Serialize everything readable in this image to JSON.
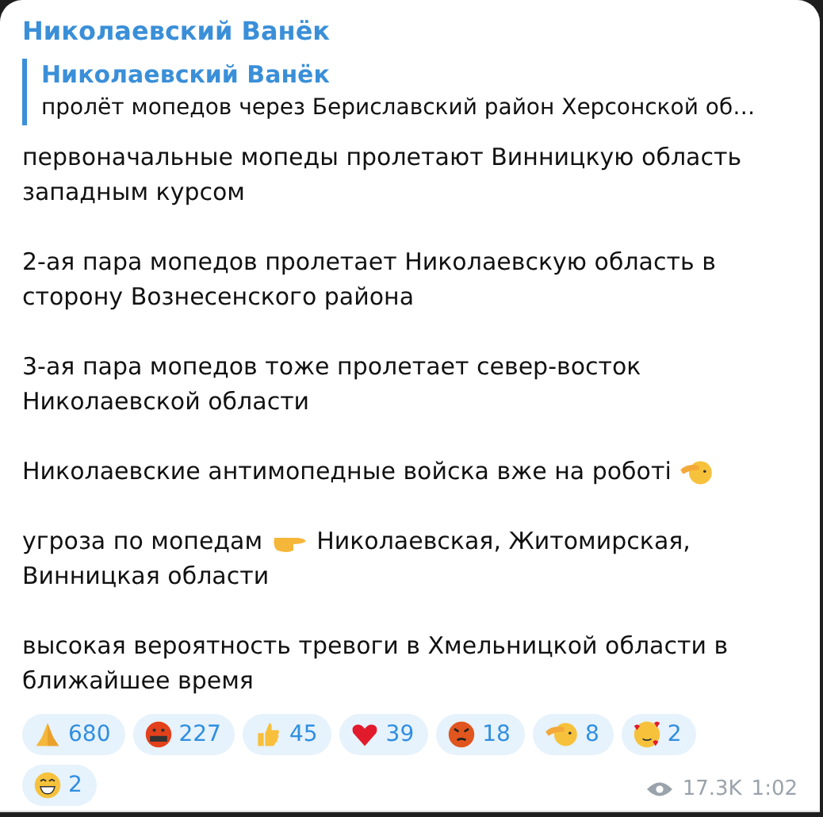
{
  "channel": {
    "name": "Николаевский Ванёк"
  },
  "reply": {
    "author": "Николаевский Ванёк",
    "text": "пролёт мопедов через Бериславский район Херсонской об…"
  },
  "paragraphs": [
    {
      "parts": [
        {
          "kind": "text",
          "text": "первоначальные мопеды пролетают Винницкую область западным курсом"
        }
      ]
    },
    {
      "parts": [
        {
          "kind": "text",
          "text": "2-ая пара мопедов пролетает Николаевскую область в сторону Вознесенского района"
        }
      ]
    },
    {
      "parts": [
        {
          "kind": "text",
          "text": "3-ая пара мопедов тоже пролетает север-восток Николаевской области"
        }
      ]
    },
    {
      "parts": [
        {
          "kind": "text",
          "text": "Николаевские антимопедные войска вже на роботі"
        },
        {
          "kind": "salute"
        }
      ]
    },
    {
      "parts": [
        {
          "kind": "text",
          "text": "угроза по мопедам"
        },
        {
          "kind": "point"
        },
        {
          "kind": "text",
          "text": "Николаевская, Житомирская,"
        },
        {
          "kind": "text",
          "text": "Винницкая области"
        }
      ]
    },
    {
      "parts": [
        {
          "kind": "text",
          "text": "высокая вероятность тревоги в Хмельницкой области в ближайшее время"
        }
      ]
    }
  ],
  "reactions": [
    {
      "kind": "pray",
      "count": "680"
    },
    {
      "kind": "cursing",
      "count": "227"
    },
    {
      "kind": "thumbs",
      "count": "45"
    },
    {
      "kind": "heart",
      "count": "39"
    },
    {
      "kind": "angry",
      "count": "18"
    },
    {
      "kind": "salute",
      "count": "8"
    },
    {
      "kind": "hearts",
      "count": "2"
    },
    {
      "kind": "grin",
      "count": "2"
    }
  ],
  "views": "17.3K",
  "time": "1:02"
}
